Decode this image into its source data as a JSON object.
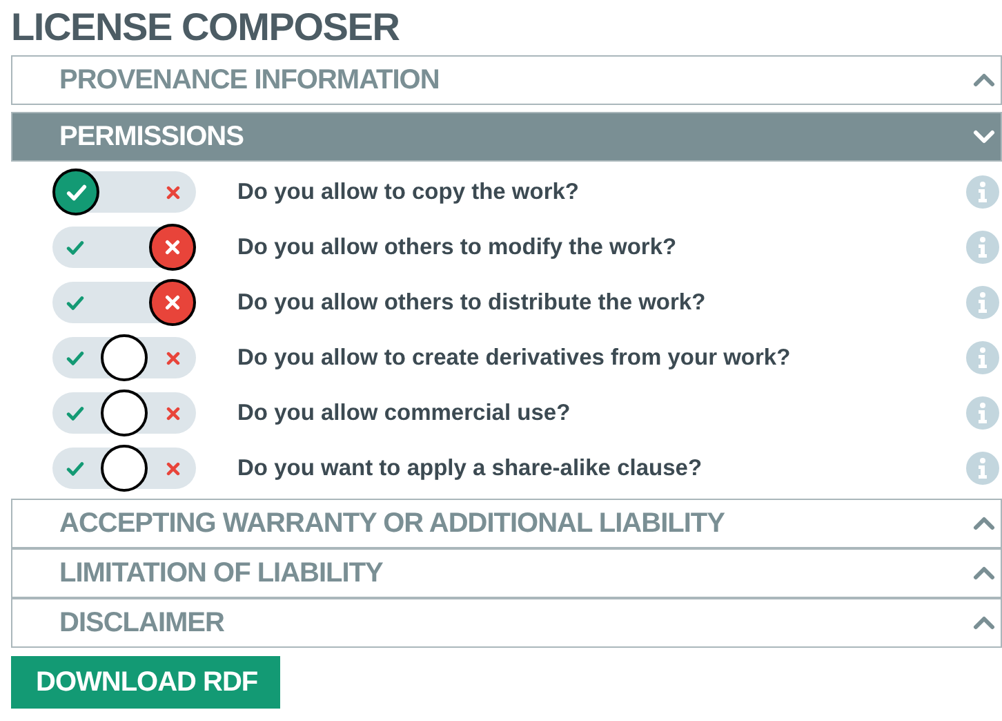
{
  "title": "LICENSE COMPOSER",
  "sections": [
    {
      "label": "PROVENANCE INFORMATION",
      "expanded": false
    },
    {
      "label": "PERMISSIONS",
      "expanded": true,
      "questions": [
        {
          "text": "Do you allow to copy the work?",
          "yes": true,
          "no": false
        },
        {
          "text": "Do you allow others to modify the work?",
          "yes": false,
          "no": true
        },
        {
          "text": "Do you allow others to distribute the work?",
          "yes": false,
          "no": true
        },
        {
          "text": "Do you allow to create derivatives from your work?",
          "yes": false,
          "no": false
        },
        {
          "text": "Do you allow commercial use?",
          "yes": false,
          "no": false
        },
        {
          "text": "Do you want to apply a share-alike clause?",
          "yes": false,
          "no": false
        }
      ]
    },
    {
      "label": "ACCEPTING WARRANTY OR ADDITIONAL LIABILITY",
      "expanded": false
    },
    {
      "label": "LIMITATION OF LIABILITY",
      "expanded": false
    },
    {
      "label": "DISCLAIMER",
      "expanded": false
    }
  ],
  "download_button": "DOWNLOAD RDF"
}
